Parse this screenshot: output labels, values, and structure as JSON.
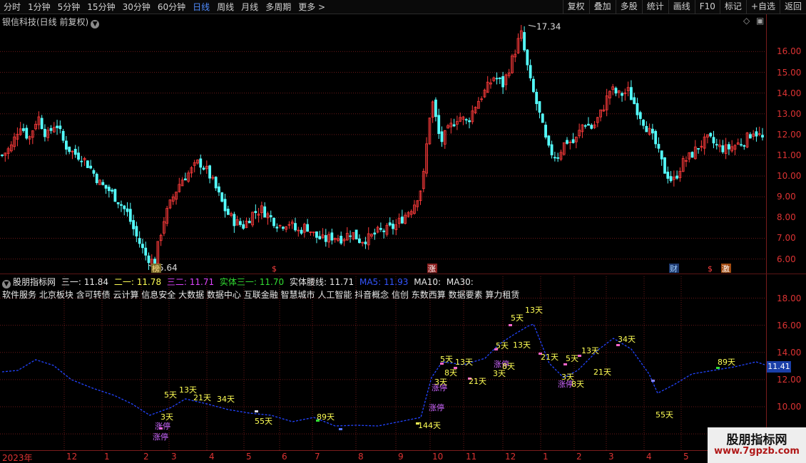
{
  "toolbar": {
    "periods": [
      "分时",
      "1分钟",
      "5分钟",
      "15分钟",
      "30分钟",
      "60分钟",
      "日线",
      "周线",
      "月线",
      "多周期",
      "更多 >"
    ],
    "active_period": "日线",
    "tools": [
      "复权",
      "叠加",
      "多股",
      "统计",
      "画线",
      "F10",
      "标记",
      "+自选",
      "返回"
    ]
  },
  "main": {
    "title": "银信科技(日线 前复权)",
    "high_label": "17.34",
    "low_label": "5.64",
    "y_ticks": [
      "16.00",
      "15.00",
      "14.00",
      "13.00",
      "12.00",
      "11.00",
      "10.00",
      "9.00",
      "8.00",
      "7.00",
      "6.00"
    ],
    "event_marks": [
      "榜",
      "$",
      "涨",
      "财",
      "$",
      "激"
    ]
  },
  "indicator": {
    "name": "股朋指标网",
    "values": [
      {
        "label": "三一: 11.84",
        "color": "#e8e8e8"
      },
      {
        "label": "二一: 11.78",
        "color": "#ffff55"
      },
      {
        "label": "三二: 11.71",
        "color": "#dd44ff"
      },
      {
        "label": "实体三一: 11.70",
        "color": "#33dd33"
      },
      {
        "label": "实体腰线: 11.71",
        "color": "#e8e8e8"
      },
      {
        "label": "MA5: 11.93",
        "color": "#3355ff"
      },
      {
        "label": "MA10:",
        "color": "#e8e8e8"
      },
      {
        "label": "MA30:",
        "color": "#e8e8e8"
      }
    ],
    "concepts": "软件服务 北京板块 含可转债 云计算 信息安全 大数据 数据中心 互联金融 智慧城市 人工智能 抖音概念 信创 东数西算 数据要素 算力租赁",
    "y_ticks": [
      "18.00",
      "16.00",
      "14.00",
      "12.00",
      "10.00",
      "8.00"
    ],
    "last_value": "11.41",
    "markers": [
      {
        "text": "涨停",
        "color": "#cc66ff"
      },
      {
        "text": "涨停",
        "color": "#cc66ff"
      },
      {
        "text": "3天",
        "color": "#ffff55"
      },
      {
        "text": "5天",
        "color": "#ffff55"
      },
      {
        "text": "13天",
        "color": "#ffff55"
      },
      {
        "text": "21天",
        "color": "#ffff55"
      },
      {
        "text": "34天",
        "color": "#ffff55"
      },
      {
        "text": "55天",
        "color": "#ffff55"
      },
      {
        "text": "89天",
        "color": "#ffff55"
      },
      {
        "text": "144天",
        "color": "#ffff55"
      },
      {
        "text": "涨停",
        "color": "#cc66ff"
      },
      {
        "text": "涨停",
        "color": "#cc66ff"
      },
      {
        "text": "5天",
        "color": "#ffff55"
      },
      {
        "text": "8天",
        "color": "#ffff55"
      },
      {
        "text": "3天",
        "color": "#ffff55"
      },
      {
        "text": "13天",
        "color": "#ffff55"
      },
      {
        "text": "21天",
        "color": "#ffff55"
      },
      {
        "text": "5天",
        "color": "#ffff55"
      },
      {
        "text": "13天",
        "color": "#ffff55"
      },
      {
        "text": "涨停",
        "color": "#cc66ff"
      },
      {
        "text": "3天",
        "color": "#ffff55"
      },
      {
        "text": "8天",
        "color": "#ffff55"
      },
      {
        "text": "5天",
        "color": "#ffff55"
      },
      {
        "text": "13天",
        "color": "#ffff55"
      },
      {
        "text": "21天",
        "color": "#ffff55"
      },
      {
        "text": "5天",
        "color": "#ffff55"
      },
      {
        "text": "13天",
        "color": "#ffff55"
      },
      {
        "text": "3天",
        "color": "#ffff55"
      },
      {
        "text": "涨停",
        "color": "#cc66ff"
      },
      {
        "text": "8天",
        "color": "#ffff55"
      },
      {
        "text": "21天",
        "color": "#ffff55"
      },
      {
        "text": "34天",
        "color": "#ffff55"
      },
      {
        "text": "55天",
        "color": "#ffff55"
      },
      {
        "text": "89天",
        "color": "#ffff55"
      }
    ]
  },
  "date_axis": [
    "2023年",
    "12",
    "1",
    "2",
    "3",
    "4",
    "5",
    "6",
    "7",
    "8",
    "9",
    "10",
    "11",
    "12",
    "1",
    "2",
    "3",
    "4",
    "5"
  ],
  "watermark": {
    "title": "股朋指标网",
    "url": "www.7gpzb.com"
  },
  "colors": {
    "up": "#ff3b3b",
    "down": "#54ffff",
    "ma": "#2244ff",
    "grid": "#7a1c1c",
    "axis_text": "#dd3333"
  },
  "chart_data": {
    "type": "candlestick",
    "y_range": [
      5.3,
      17.8
    ],
    "highest": 17.34,
    "lowest": 5.64,
    "close_path": [
      11.0,
      11.4,
      12.5,
      11.8,
      12.9,
      11.9,
      12.6,
      11.5,
      11.1,
      10.9,
      10.3,
      9.6,
      9.3,
      8.8,
      8.2,
      7.1,
      6.2,
      5.8,
      7.8,
      8.9,
      9.8,
      10.2,
      10.7,
      10.2,
      9.3,
      8.3,
      7.8,
      7.6,
      8.2,
      8.4,
      8.0,
      7.6,
      7.8,
      7.3,
      7.6,
      7.1,
      6.9,
      7.1,
      7.0,
      7.3,
      6.9,
      7.0,
      7.3,
      7.4,
      7.6,
      8.1,
      8.6,
      9.6,
      13.8,
      11.6,
      12.3,
      12.9,
      12.6,
      13.5,
      14.1,
      14.8,
      14.4,
      15.6,
      16.9,
      14.6,
      13.1,
      11.3,
      10.9,
      11.7,
      11.6,
      12.6,
      12.3,
      13.1,
      14.2,
      13.9,
      14.1,
      13.2,
      12.4,
      11.6,
      10.3,
      9.7,
      10.6,
      11.0,
      11.5,
      11.8,
      11.4,
      11.3,
      11.5,
      11.7,
      12.2,
      11.8
    ]
  }
}
